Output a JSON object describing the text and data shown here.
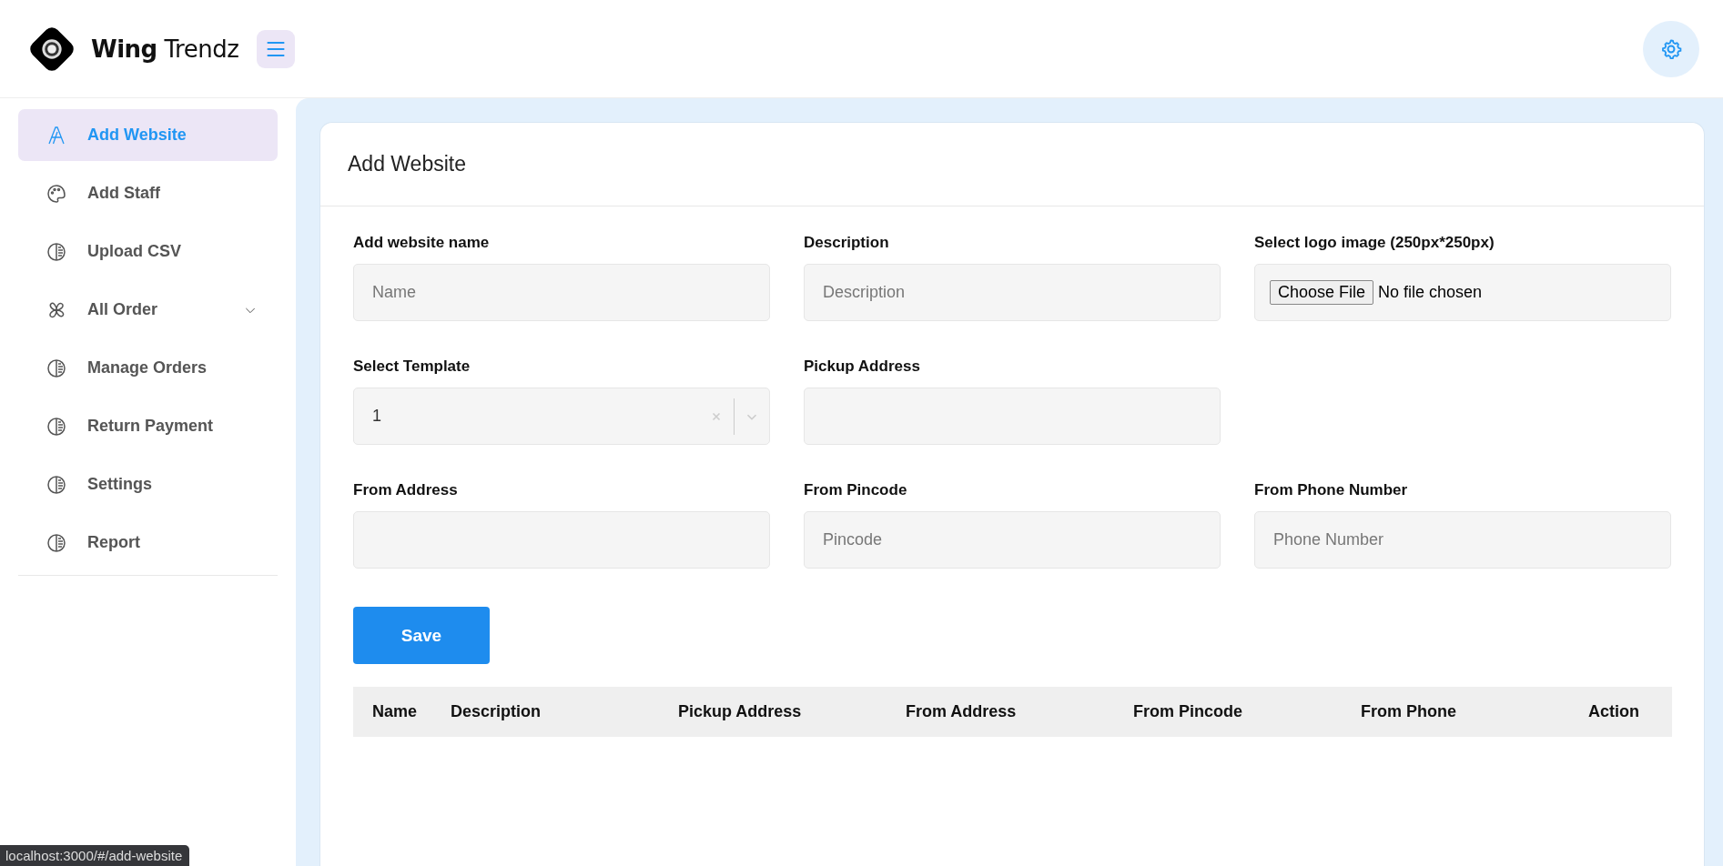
{
  "brand": {
    "name": "**Wing** Trendz"
  },
  "sidebar": {
    "items": [
      {
        "label": "Add Website",
        "kind": "letter",
        "selected": true,
        "expandable": false
      },
      {
        "label": "Add Staff",
        "kind": "palette",
        "selected": false,
        "expandable": false
      },
      {
        "label": "Upload CSV",
        "kind": "chart",
        "selected": false,
        "expandable": false
      },
      {
        "label": "All Order",
        "kind": "group",
        "selected": false,
        "expandable": true
      },
      {
        "label": "Manage Orders",
        "kind": "chart",
        "selected": false,
        "expandable": false
      },
      {
        "label": "Return Payment",
        "kind": "chart",
        "selected": false,
        "expandable": false
      },
      {
        "label": "Settings",
        "kind": "chart",
        "selected": false,
        "expandable": false
      },
      {
        "label": "Report",
        "kind": "chart",
        "selected": false,
        "expandable": false
      }
    ]
  },
  "card": {
    "title": "Add Website"
  },
  "form": {
    "rows": [
      [
        {
          "kind": "text",
          "label": "Add website name",
          "placeholder": "Name"
        },
        {
          "kind": "text",
          "label": "Description",
          "placeholder": "Description"
        },
        {
          "kind": "file",
          "label": "Select logo image (250px*250px)",
          "button": "Choose File",
          "status": "No file chosen"
        }
      ],
      [
        {
          "kind": "select",
          "label": "Select Template",
          "value": "1"
        },
        {
          "kind": "text",
          "label": "Pickup Address"
        }
      ],
      [
        {
          "kind": "text",
          "label": "From Address"
        },
        {
          "kind": "text",
          "label": "From Pincode",
          "placeholder": "Pincode"
        },
        {
          "kind": "text",
          "label": "From Phone Number",
          "placeholder": "Phone Number"
        }
      ]
    ],
    "save_button": "Save"
  },
  "table": {
    "columns": [
      "Name",
      "Description",
      "Pickup Address",
      "From Address",
      "From Pincode",
      "From Phone",
      "Action"
    ]
  },
  "status_bar": {
    "url": "localhost:3000/#/add-website"
  }
}
